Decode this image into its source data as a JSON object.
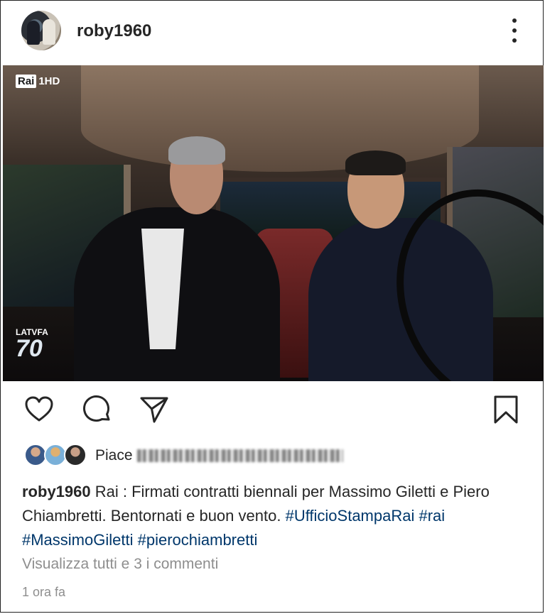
{
  "post": {
    "username": "roby1960",
    "more_icon": "more-vertical-icon"
  },
  "media": {
    "channel_logo_brand": "Rai",
    "channel_logo_suffix": "1HD",
    "show_logo_line1": "LATVFA",
    "show_logo_line2": "70"
  },
  "actions": {
    "like_icon": "heart-icon",
    "comment_icon": "comment-bubble-icon",
    "share_icon": "paper-plane-icon",
    "save_icon": "bookmark-icon"
  },
  "likes": {
    "prefix": "Piace"
  },
  "caption": {
    "user": "roby1960",
    "text": "Rai : Firmati contratti biennali per Massimo Giletti e Piero Chiambretti. Bentornati e buon vento.",
    "hashtags": [
      "#UfficioStampaRai",
      "#rai",
      "#MassimoGiletti",
      "#pierochiambretti"
    ]
  },
  "comments_link": "Visualizza tutti e 3 i commenti",
  "timestamp": "1 ora fa",
  "colors": {
    "text": "#262626",
    "secondary": "#8e8e8e",
    "hashtag": "#00376b"
  }
}
